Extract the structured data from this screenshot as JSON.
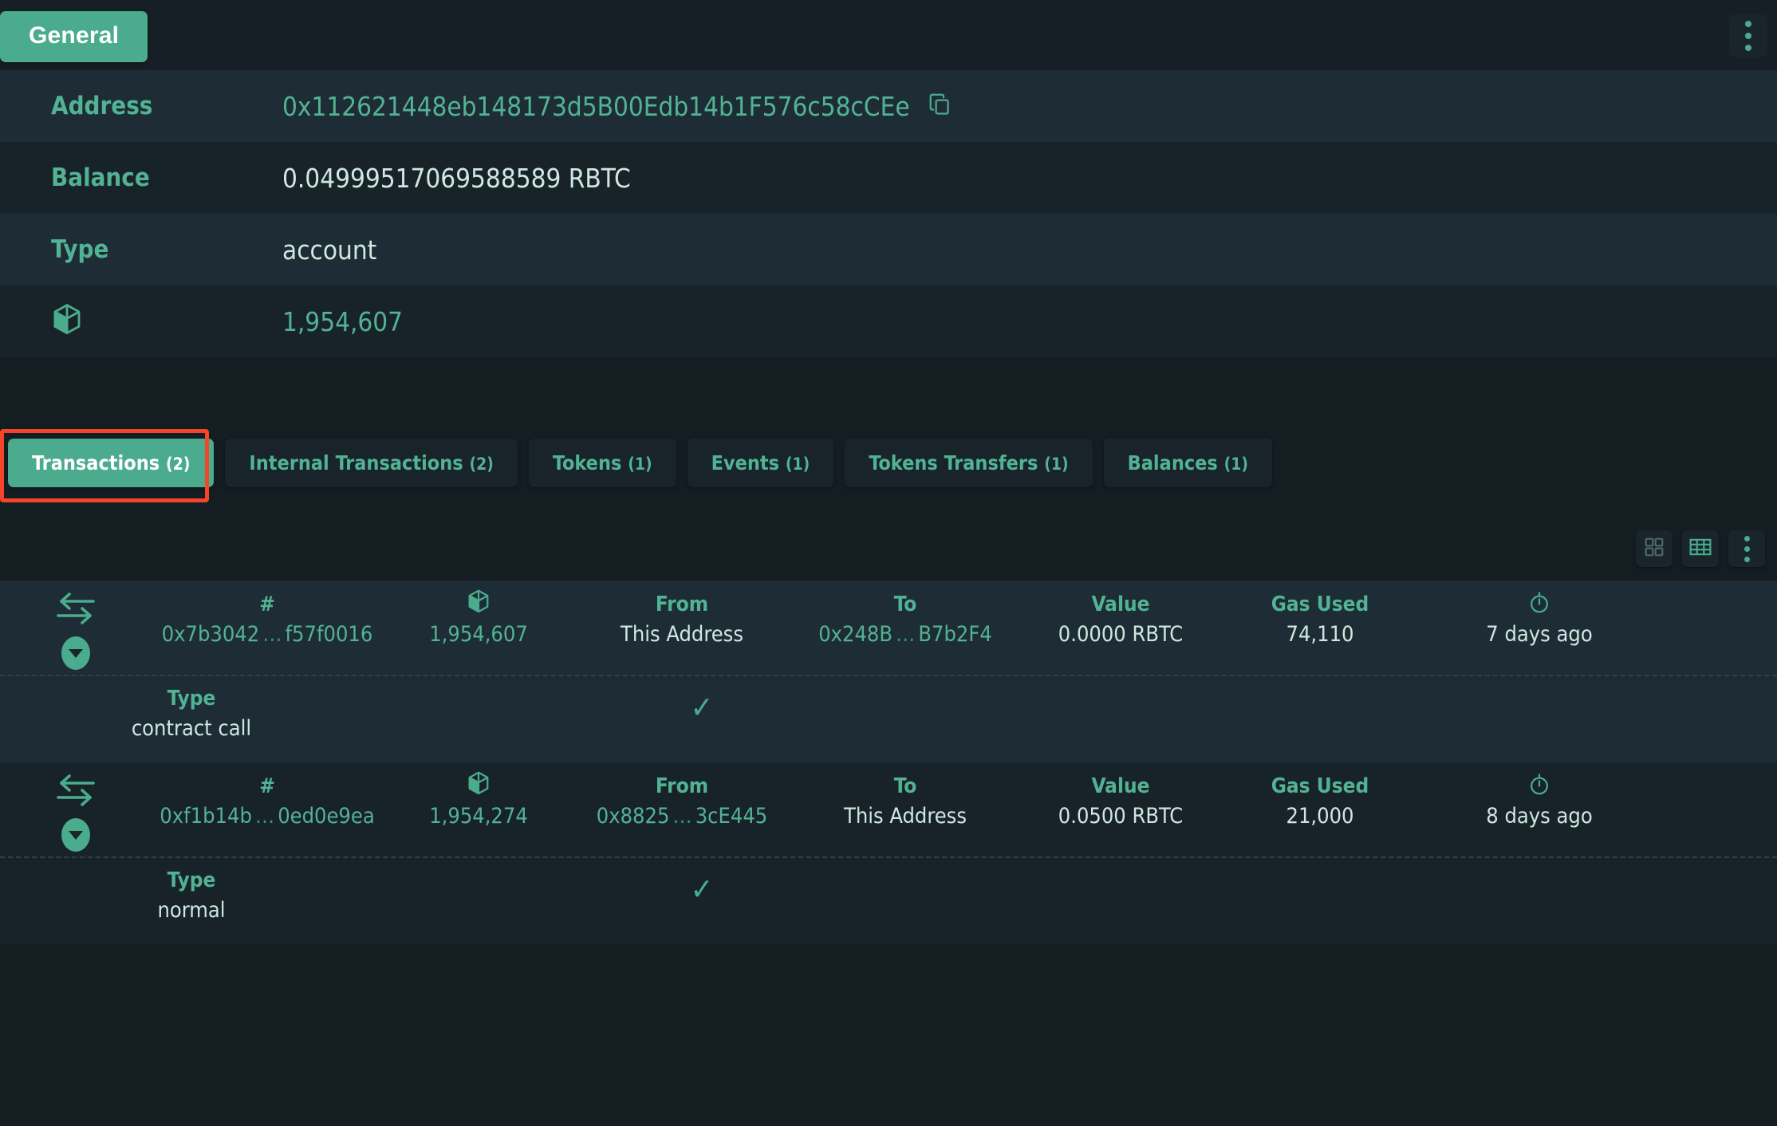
{
  "topbar": {
    "general_label": "General",
    "menu_icon": "vertical-dots-icon"
  },
  "general": {
    "rows": [
      {
        "label": "Address",
        "value": "0x112621448eb148173d5B00Edb14b1F576c58cCEe",
        "copy_icon": "copy-icon"
      },
      {
        "label": "Balance",
        "value": "0.04999517069588589 RBTC"
      },
      {
        "label": "Type",
        "value": "account"
      },
      {
        "label_icon": "cube-icon",
        "value": "1,954,607"
      }
    ]
  },
  "tabs": [
    {
      "label": "Transactions",
      "count": "(2)",
      "active": true
    },
    {
      "label": "Internal Transactions",
      "count": "(2)",
      "active": false
    },
    {
      "label": "Tokens",
      "count": "(1)",
      "active": false
    },
    {
      "label": "Events",
      "count": "(1)",
      "active": false
    },
    {
      "label": "Tokens Transfers",
      "count": "(1)",
      "active": false
    },
    {
      "label": "Balances",
      "count": "(1)",
      "active": false
    }
  ],
  "toolbar": {
    "grid_view_icon": "grid-view-icon",
    "table_view_icon": "table-view-icon",
    "more_icon": "vertical-dots-icon"
  },
  "table": {
    "headers": {
      "hash": "#",
      "block": "cube-icon",
      "from": "From",
      "to": "To",
      "value": "Value",
      "gas_used": "Gas Used",
      "time": "stopwatch-icon",
      "type": "Type"
    },
    "rows": [
      {
        "hash_prefix": "0x7b3042",
        "hash_suffix": "f57f0016",
        "block": "1,954,607",
        "from": "This Address",
        "from_is_link": false,
        "to_prefix": "0x248B",
        "to_suffix": "B7b2F4",
        "to_is_link": true,
        "value": "0.0000 RBTC",
        "gas_used": "74,110",
        "time": "7 days ago",
        "type_label": "Type",
        "type_value": "contract call",
        "status": "✓"
      },
      {
        "hash_prefix": "0xf1b14b",
        "hash_suffix": "0ed0e9ea",
        "block": "1,954,274",
        "from_prefix": "0x8825",
        "from_suffix": "3cE445",
        "from_is_link": true,
        "to": "This Address",
        "to_is_link": false,
        "value": "0.0500 RBTC",
        "gas_used": "21,000",
        "time": "8 days ago",
        "type_label": "Type",
        "type_value": "normal",
        "status": "✓"
      }
    ]
  },
  "colors": {
    "accent": "#4aab8d",
    "link": "#52b394",
    "text": "#cfe8e0",
    "bg_dark": "#141d22",
    "row_light": "#1e2d35",
    "row_dark": "#182329",
    "highlight": "#f4452a"
  }
}
